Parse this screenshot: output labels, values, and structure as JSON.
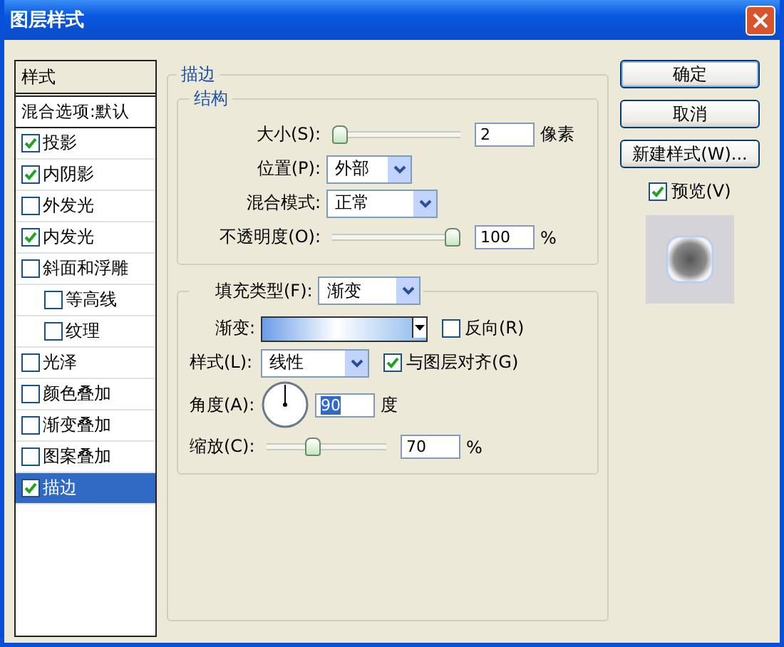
{
  "window": {
    "title": "图层样式"
  },
  "sidebar": {
    "items": [
      {
        "kind": "header",
        "label": "样式",
        "selected": false
      },
      {
        "kind": "plain",
        "label": "混合选项:默认",
        "selected": false
      },
      {
        "kind": "check",
        "label": "投影",
        "checked": true,
        "selected": false
      },
      {
        "kind": "check",
        "label": "内阴影",
        "checked": true,
        "selected": false
      },
      {
        "kind": "check",
        "label": "外发光",
        "checked": false,
        "selected": false
      },
      {
        "kind": "check",
        "label": "内发光",
        "checked": true,
        "selected": false
      },
      {
        "kind": "check",
        "label": "斜面和浮雕",
        "checked": false,
        "selected": false,
        "children": [
          {
            "kind": "check",
            "label": "等高线",
            "checked": false,
            "selected": false
          },
          {
            "kind": "check",
            "label": "纹理",
            "checked": false,
            "selected": false
          }
        ]
      },
      {
        "kind": "check",
        "label": "光泽",
        "checked": false,
        "selected": false
      },
      {
        "kind": "check",
        "label": "颜色叠加",
        "checked": false,
        "selected": false
      },
      {
        "kind": "check",
        "label": "渐变叠加",
        "checked": false,
        "selected": false
      },
      {
        "kind": "check",
        "label": "图案叠加",
        "checked": false,
        "selected": false
      },
      {
        "kind": "check",
        "label": "描边",
        "checked": true,
        "selected": true
      }
    ]
  },
  "panel": {
    "title": "描边",
    "structure": {
      "title": "结构",
      "size": {
        "label": "大小(S):",
        "level": 0.0,
        "value": "2",
        "unit": "像素"
      },
      "position": {
        "label": "位置(P):",
        "value": "外部"
      },
      "blend_mode": {
        "label": "混合模式:",
        "value": "正常"
      },
      "opacity": {
        "label": "不透明度(O):",
        "level": 1.0,
        "value": "100",
        "unit": "%"
      }
    },
    "fill": {
      "type_label": "填充类型(F):",
      "type_value": "渐变",
      "gradient_label": "渐变:",
      "reverse": {
        "label": "反向(R)",
        "checked": false
      },
      "style": {
        "label": "样式(L):",
        "value": "线性"
      },
      "align": {
        "label": "与图层对齐(G)",
        "checked": true
      },
      "angle": {
        "label": "角度(A):",
        "value": "90",
        "unit": "度"
      },
      "scale": {
        "label": "缩放(C):",
        "level": 0.37,
        "value": "70",
        "unit": "%"
      }
    }
  },
  "buttons": [
    {
      "label": "确定",
      "default": true
    },
    {
      "label": "取消",
      "default": false
    },
    {
      "label": "新建样式(W)...",
      "default": false
    }
  ],
  "preview": {
    "label": "预览(V)",
    "checked": true
  }
}
